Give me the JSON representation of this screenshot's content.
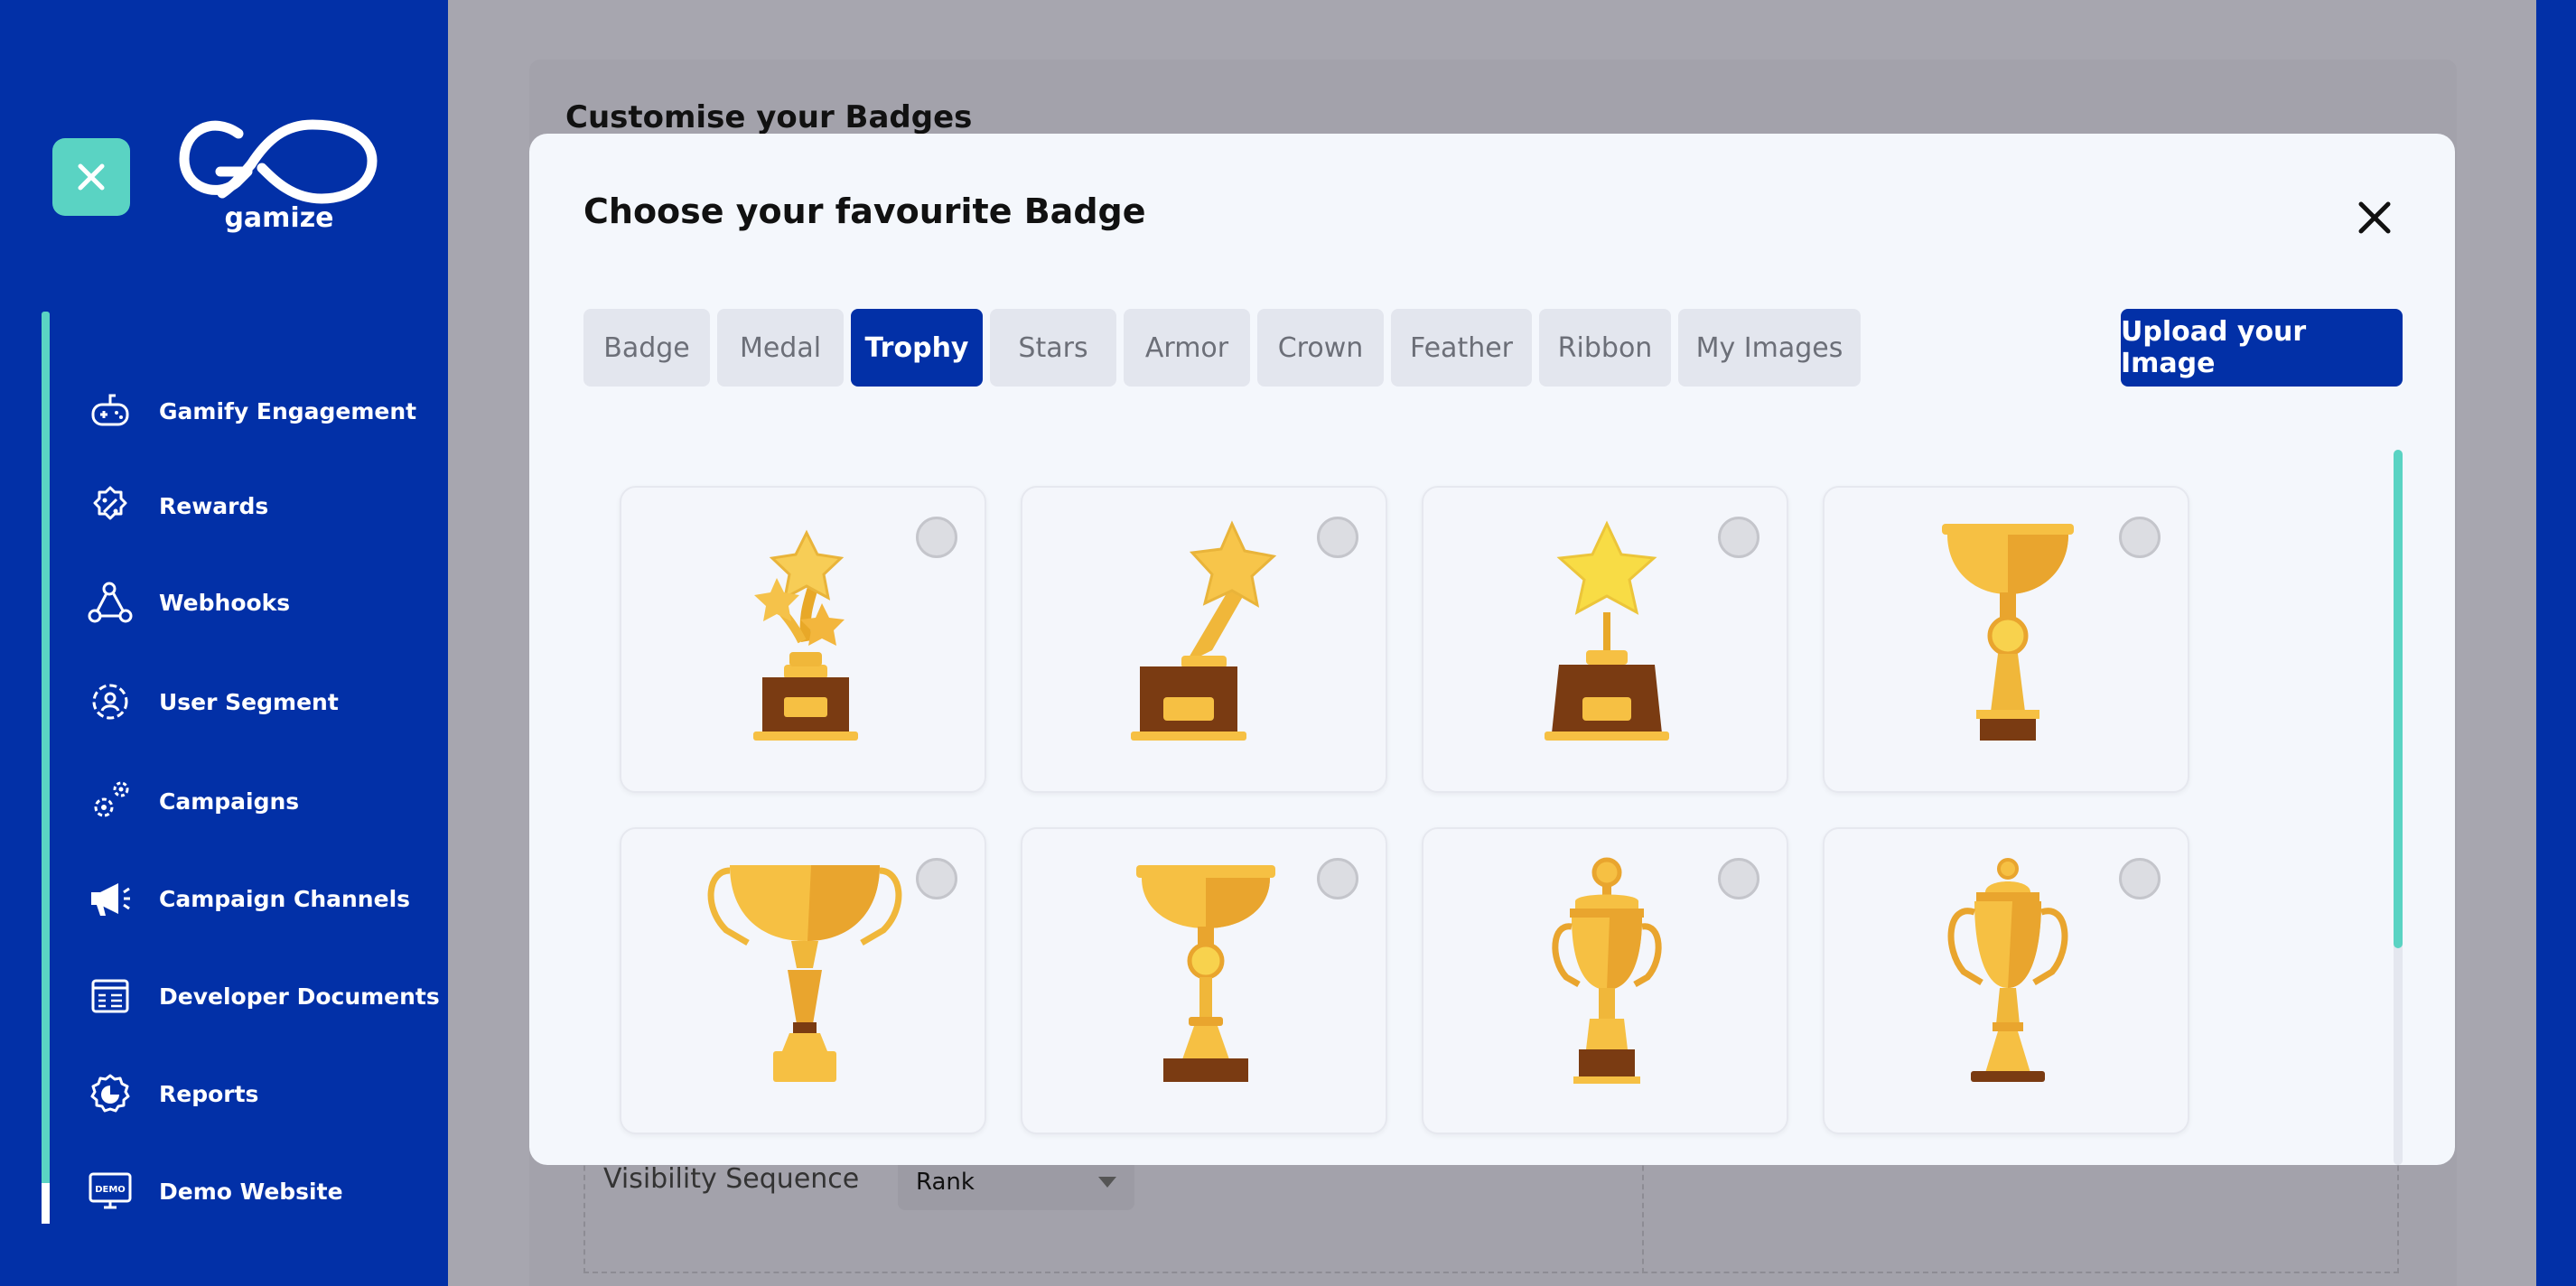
{
  "app": {
    "logo_text": "gamize",
    "nav_items": [
      {
        "label": "Gamify Engagement",
        "icon": "gamepad-icon"
      },
      {
        "label": "Rewards",
        "icon": "percent-badge-icon"
      },
      {
        "label": "Webhooks",
        "icon": "webhook-icon"
      },
      {
        "label": "User Segment",
        "icon": "user-target-icon"
      },
      {
        "label": "Campaigns",
        "icon": "gears-icon"
      },
      {
        "label": "Campaign Channels",
        "icon": "megaphone-icon"
      },
      {
        "label": "Developer Documents",
        "icon": "browser-code-icon"
      },
      {
        "label": "Reports",
        "icon": "pie-chart-gear-icon"
      },
      {
        "label": "Demo Website",
        "icon": "demo-monitor-icon"
      }
    ]
  },
  "background_page": {
    "title": "Customise your Badges",
    "visibility_label": "Visibility Sequence",
    "visibility_value": "Rank"
  },
  "modal": {
    "title": "Choose your favourite Badge",
    "tabs": [
      "Badge",
      "Medal",
      "Trophy",
      "Stars",
      "Armor",
      "Crown",
      "Feather",
      "Ribbon",
      "My Images"
    ],
    "active_tab": "Trophy",
    "upload_label": "Upload your Image",
    "trophies": [
      {
        "icon": "three-stars-trophy-icon",
        "selected": false
      },
      {
        "icon": "tilted-star-trophy-icon",
        "selected": false
      },
      {
        "icon": "star-trophy-icon",
        "selected": false
      },
      {
        "icon": "cup-trophy-icon",
        "selected": false
      },
      {
        "icon": "handled-cup-trophy-icon",
        "selected": false
      },
      {
        "icon": "tall-cup-trophy-icon",
        "selected": false
      },
      {
        "icon": "lidded-cup-trophy-icon",
        "selected": false
      },
      {
        "icon": "classic-cup-trophy-icon",
        "selected": false
      }
    ]
  },
  "colors": {
    "brand_blue": "#0230a7",
    "accent_teal": "#5ad3c3",
    "gold": "#f6c043",
    "bronze": "#7a3b12"
  }
}
